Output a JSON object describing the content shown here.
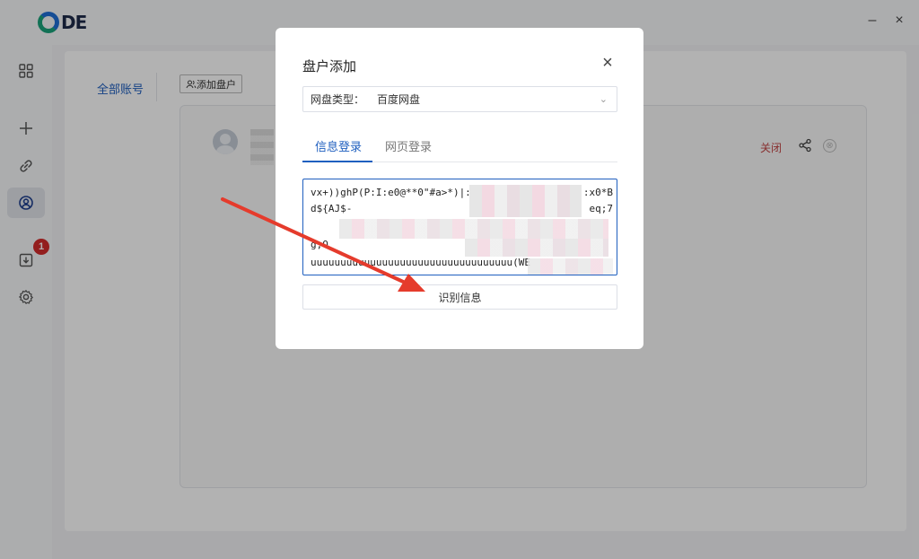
{
  "app": {
    "logo_text": "DE"
  },
  "window": {
    "minimize": "–",
    "close": "×"
  },
  "rail": {
    "items": [
      {
        "name": "grid-icon"
      },
      {
        "name": "plus-icon"
      },
      {
        "name": "link-icon"
      },
      {
        "name": "user-circle-icon",
        "active": true
      },
      {
        "name": "download-icon",
        "badge": "1"
      },
      {
        "name": "gear-icon"
      }
    ]
  },
  "main": {
    "account_tab": "全部账号",
    "add_button": "添加盘户",
    "row": {
      "close_label": "关闭",
      "remove_glyph": "⊗"
    }
  },
  "modal": {
    "title": "盘户添加",
    "close_glyph": "×",
    "disk_type": {
      "label": "网盘类型：",
      "value": "百度网盘"
    },
    "tabs": [
      {
        "label": "信息登录",
        "active": true
      },
      {
        "label": "网页登录",
        "active": false
      }
    ],
    "textarea_lines": [
      "vx+))ghP(P:I:e0@**0\"#a>*)|:.;e!",
      "d${AJ$-",
      "g;O",
      "uuuuuuuuuuuuuuuuuuuuuuuuuuuuuuuuuu(WE"
    ],
    "textarea_right_fragments": [
      ":x0*B",
      "eq;7"
    ],
    "recognize_button": "识别信息"
  },
  "colors": {
    "accent": "#1f5fbf",
    "danger": "#c24545",
    "badge": "#d32b2b",
    "arrow": "#e53b2c"
  }
}
